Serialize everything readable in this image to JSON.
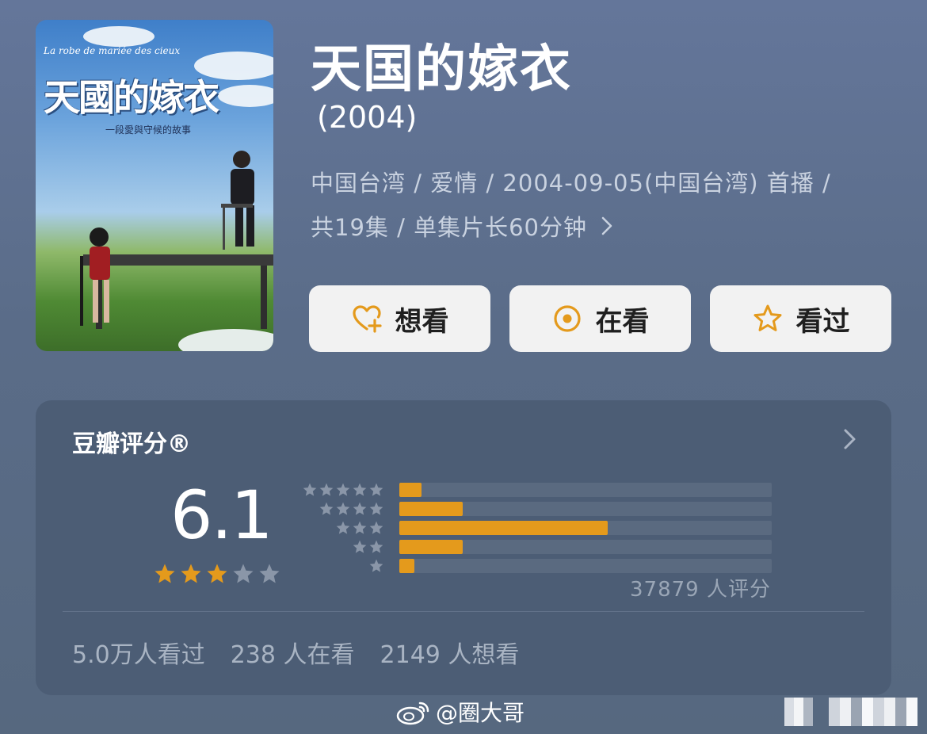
{
  "poster": {
    "subtitle": "La robe de mariée des cieux",
    "title": "天國的嫁衣",
    "tagline": "一段愛與守候的故事"
  },
  "title": "天国的嫁衣",
  "year": "(2004)",
  "meta": {
    "line1": "中国台湾 / 爱情 / 2004-09-05(中国台湾) 首播 /",
    "line2": "共19集 / 单集片长60分钟"
  },
  "actions": [
    {
      "label": "想看",
      "icon": "heart-plus-icon"
    },
    {
      "label": "在看",
      "icon": "target-circle-icon"
    },
    {
      "label": "看过",
      "icon": "star-outline-icon"
    }
  ],
  "rating": {
    "card_title": "豆瓣评分®",
    "score": "6.1",
    "stars_filled": 3,
    "stars_total": 5,
    "distribution": [
      {
        "stars": 5,
        "fraction": 0.06
      },
      {
        "stars": 4,
        "fraction": 0.17
      },
      {
        "stars": 3,
        "fraction": 0.56
      },
      {
        "stars": 2,
        "fraction": 0.17
      },
      {
        "stars": 1,
        "fraction": 0.04
      }
    ],
    "count_text": "37879 人评分",
    "stats": [
      "5.0万人看过",
      "238 人在看",
      "2149 人想看"
    ]
  },
  "watermark": "@圈大哥",
  "colors": {
    "accent": "#e49a1c",
    "background": "#5c6e88",
    "card": "#4c5d75",
    "button": "#f2f2f2"
  }
}
